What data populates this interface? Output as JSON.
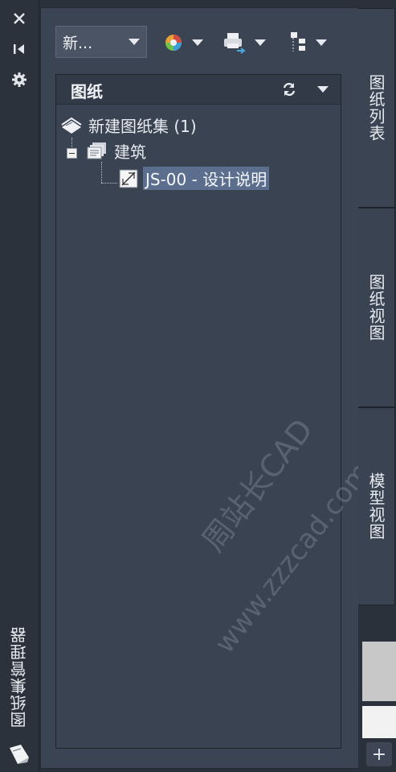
{
  "palette": {
    "title": "图纸集管理器",
    "close_icon": "close-icon",
    "autohide_icon": "autohide-icon",
    "properties_icon": "gear-icon"
  },
  "toolbar": {
    "sheetset_dropdown": "新...",
    "tools": [
      "sheet-set-icon",
      "publish-icon",
      "sheet-selection-icon"
    ]
  },
  "tree": {
    "header": "图纸",
    "nodes": [
      {
        "label": "新建图纸集 (1)",
        "level": 0
      },
      {
        "label": "建筑",
        "level": 1,
        "expanded": true
      },
      {
        "label": "JS-00 - 设计说明",
        "level": 2,
        "selected": true
      }
    ]
  },
  "tabs": [
    "图纸列表",
    "图纸视图",
    "模型视图"
  ],
  "active_tab": "图纸列表",
  "watermark": {
    "line1": "周站长CAD",
    "line2": "www.zzzcad.com"
  },
  "add_button": "+"
}
